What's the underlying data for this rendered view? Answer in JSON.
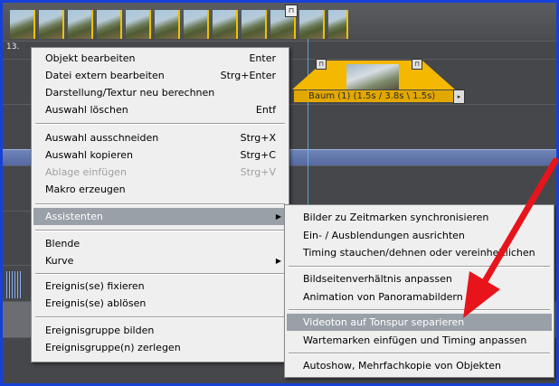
{
  "timeline": {
    "track_label": "13.",
    "object_label": "Baum (1) (1.5s / 3.8s \\ 1.5s)"
  },
  "context_menu": {
    "items": [
      {
        "label": "Objekt bearbeiten",
        "shortcut": "Enter"
      },
      {
        "label": "Datei extern bearbeiten",
        "shortcut": "Strg+Enter"
      },
      {
        "label": "Darstellung/Textur neu berechnen",
        "shortcut": ""
      },
      {
        "label": "Auswahl löschen",
        "shortcut": "Entf"
      },
      {
        "label": "Auswahl ausschneiden",
        "shortcut": "Strg+X"
      },
      {
        "label": "Auswahl kopieren",
        "shortcut": "Strg+C"
      },
      {
        "label": "Ablage einfügen",
        "shortcut": "Strg+V",
        "disabled": true
      },
      {
        "label": "Makro erzeugen",
        "shortcut": ""
      },
      {
        "label": "Assistenten",
        "shortcut": "",
        "submenu": true,
        "highlighted": true
      },
      {
        "label": "Blende",
        "shortcut": ""
      },
      {
        "label": "Kurve",
        "shortcut": "",
        "submenu": true
      },
      {
        "label": "Ereignis(se) fixieren",
        "shortcut": ""
      },
      {
        "label": "Ereignis(se) ablösen",
        "shortcut": ""
      },
      {
        "label": "Ereignisgruppe bilden",
        "shortcut": ""
      },
      {
        "label": "Ereignisgruppe(n) zerlegen",
        "shortcut": ""
      }
    ]
  },
  "submenu": {
    "items": [
      {
        "label": "Bilder zu Zeitmarken synchronisieren"
      },
      {
        "label": "Ein- / Ausblendungen ausrichten"
      },
      {
        "label": "Timing stauchen/dehnen oder vereinheitlichen"
      },
      {
        "label": "Bildseitenverhältnis anpassen"
      },
      {
        "label": "Animation von Panoramabildern"
      },
      {
        "label": "Videoton auf Tonspur separieren",
        "selected": true
      },
      {
        "label": "Wartemarken einfügen und Timing anpassen"
      },
      {
        "label": "Autoshow, Mehrfachkopie von Objekten"
      }
    ]
  },
  "colors": {
    "frame_border": "#1640d8",
    "annotation_arrow": "#e8141b",
    "clip_yellow": "#f4b800",
    "menu_highlight": "#9aa0a8"
  },
  "icons": {
    "submenu_arrow": "triangle-right-icon",
    "annotation": "red-arrow-annotation"
  }
}
